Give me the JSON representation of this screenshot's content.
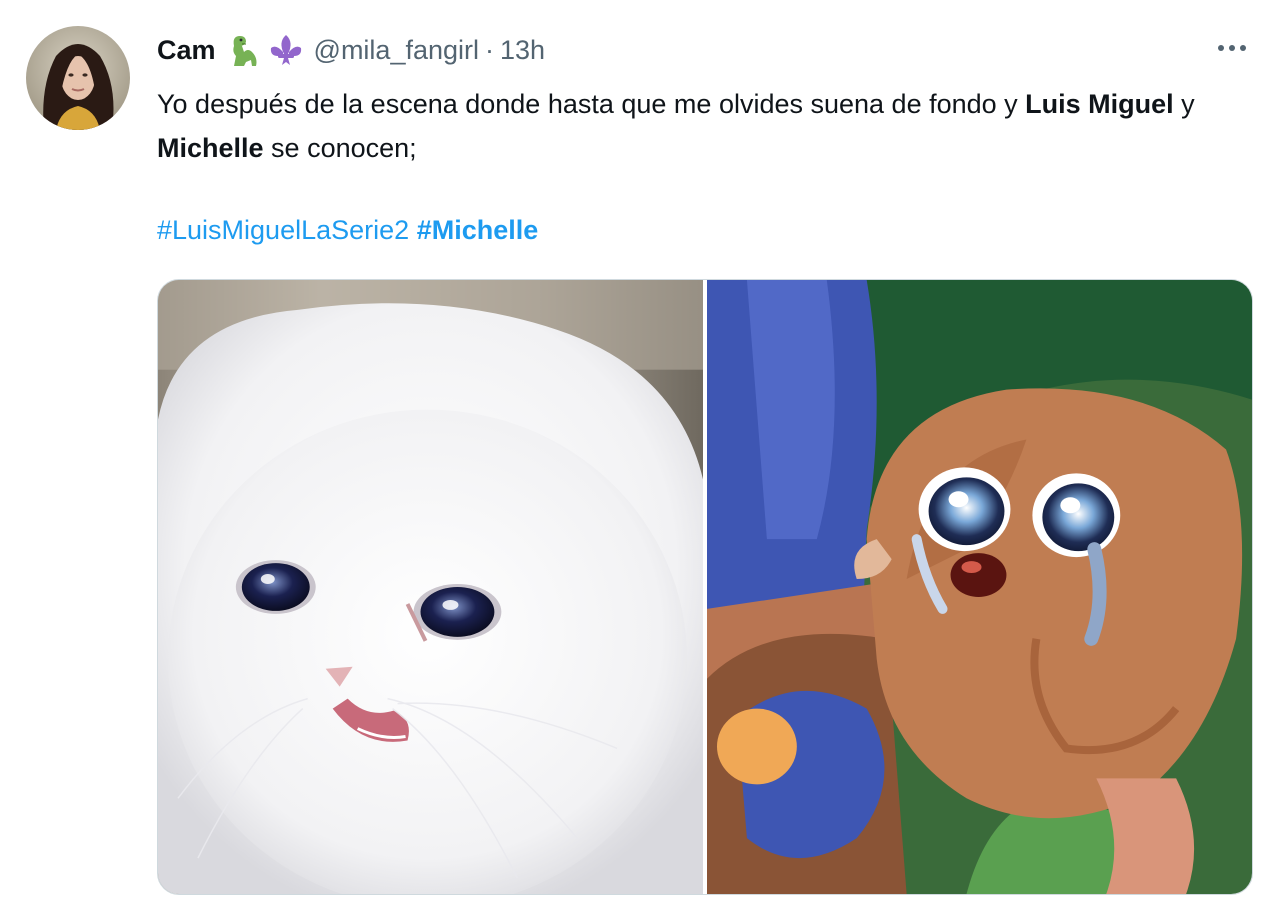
{
  "tweet": {
    "display_name": "Cam",
    "emojis": [
      "dinosaur-emoji",
      "fleur-de-lis-emoji"
    ],
    "handle": "@mila_fangirl",
    "separator": "·",
    "time": "13h",
    "text_segments": {
      "t1": "Yo después de la escena donde hasta que me olvides suena de fondo y ",
      "b1": "Luis Miguel",
      "t2": " y ",
      "b2": "Michelle",
      "t3": " se conocen;"
    },
    "hashtags": [
      "#LuisMiguelLaSerie2",
      "#Michelle"
    ],
    "media": [
      {
        "description_icon": "crying-white-cat-image"
      },
      {
        "description_icon": "crying-cartoon-mouse-image"
      }
    ]
  },
  "colors": {
    "text": "#0f1419",
    "secondary": "#536471",
    "link": "#1d9bf0",
    "border": "#cfd9de"
  },
  "icons": {
    "more": "more-horizontal-icon"
  }
}
